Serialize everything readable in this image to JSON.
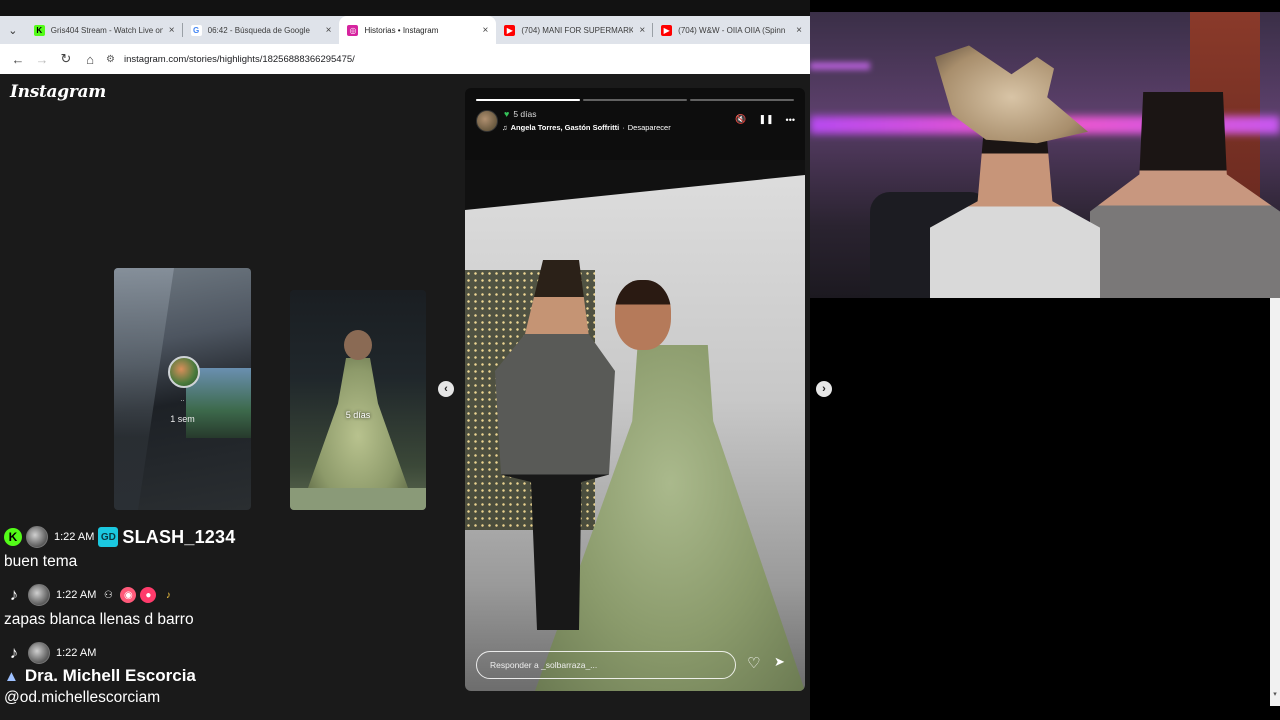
{
  "browser": {
    "tabs": [
      {
        "title": "Gris404 Stream - Watch Live on",
        "close": "×",
        "fav_color": "#53fc18",
        "fav_glyph": "K"
      },
      {
        "title": "06:42 - Búsqueda de Google",
        "close": "×",
        "fav_color": "#ffffff",
        "fav_glyph": "G"
      },
      {
        "title": "Historias • Instagram",
        "close": "×",
        "fav_color": "#d6249f",
        "fav_glyph": "◎"
      },
      {
        "title": "(704) MANI FOR SUPERMARKE",
        "close": "×",
        "fav_color": "#ff0000",
        "fav_glyph": "▶"
      },
      {
        "title": "(704) W&W - OIIA OIIA (Spinn",
        "close": "×",
        "fav_color": "#ff0000",
        "fav_glyph": "▶"
      }
    ],
    "tab_search_glyph": "⌄",
    "nav": {
      "back": "←",
      "forward": "→",
      "reload": "↻",
      "home": "⌂"
    },
    "site_info_glyph": "⚙",
    "url": "instagram.com/stories/highlights/18256888366295475/"
  },
  "instagram": {
    "logo": "Instagram",
    "previews": [
      {
        "username": "..",
        "time": "1 sem"
      },
      {
        "time": "5 días"
      }
    ],
    "prev_glyph": "‹",
    "next_glyph": "›",
    "story": {
      "progress": [
        1.0,
        0.0,
        0.0
      ],
      "time": "5 días",
      "close_friends_glyph": "♥",
      "music_glyph": "♫",
      "artists": "Angela Torres, Gastón Soffritti",
      "song_separator": "·",
      "song": "Desaparecer",
      "mute_glyph": "🔇",
      "pause_glyph": "❚❚",
      "more_glyph": "•••",
      "reply_placeholder": "Responder a _solbarraza_...",
      "heart_glyph": "♡",
      "share_glyph": "➤"
    }
  },
  "chat": {
    "messages": [
      {
        "platform": "K",
        "time": "1:22 AM",
        "badge": "GD",
        "username": "SLASH_1234",
        "text": "buen tema"
      },
      {
        "platform": "♪",
        "time": "1:22 AM",
        "badges": [
          "⚇",
          "◉",
          "●",
          "♪"
        ],
        "text": "zapas blanca llenas d barro"
      },
      {
        "platform": "♪",
        "time": "1:22 AM",
        "tier_icon": "▲",
        "username": "Dra. Michell Escorcia",
        "text": "@od.michellescorciam"
      }
    ]
  },
  "scroll_glyph": "▾"
}
